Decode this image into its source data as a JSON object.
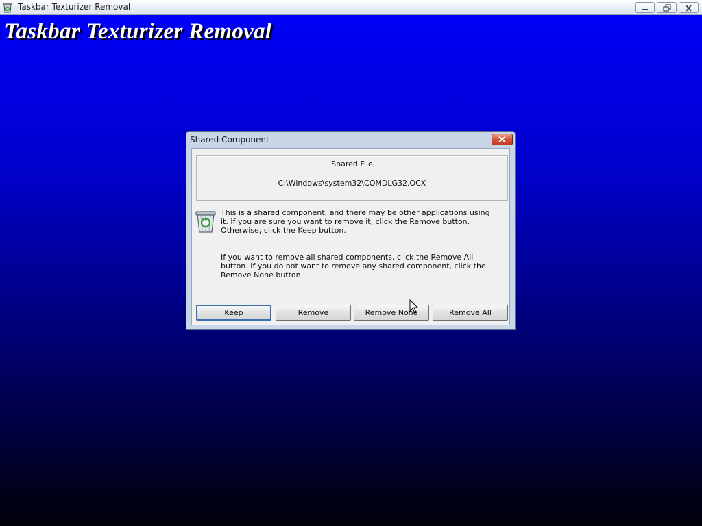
{
  "window": {
    "title": "Taskbar Texturizer Removal",
    "icon": "recycle-bin-icon",
    "controls": [
      "minimize-icon",
      "restore-icon",
      "close-icon"
    ]
  },
  "background": {
    "heading": "Taskbar Texturizer Removal",
    "gradient_colors": [
      "#0000f6",
      "#000008"
    ]
  },
  "dialog": {
    "title": "Shared Component",
    "shared_file_label": "Shared File",
    "shared_file_path": "C:\\Windows\\system32\\COMDLG32.OCX",
    "icon": "recycle-bin-icon",
    "message_1": "This is a shared component, and there may be other applications using it.  If you are sure you want to remove it, click the Remove button.  Otherwise, click the Keep button.",
    "message_2": "If you want to remove all shared components, click the Remove All button.  If you do not want to remove any shared component, click the Remove None button.",
    "buttons": {
      "keep": "Keep",
      "remove": "Remove",
      "remove_none": "Remove None",
      "remove_all": "Remove All"
    },
    "default_button": "Keep",
    "close_color": "#d2553a"
  }
}
